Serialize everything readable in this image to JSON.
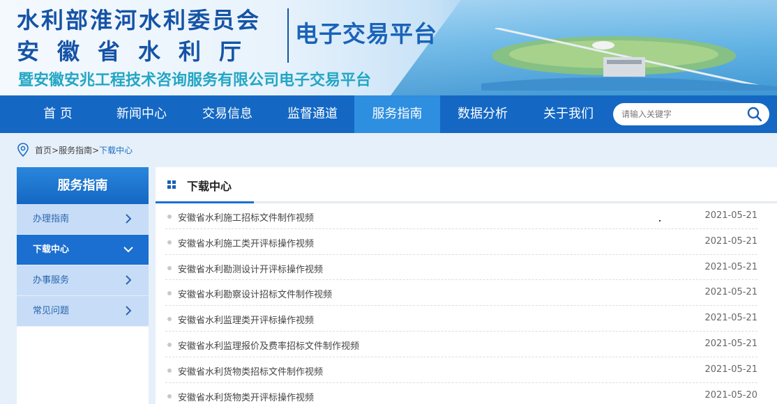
{
  "header": {
    "org_line1": "水利部淮河水利委员会",
    "org_line2": "安徽省水利厅",
    "platform": "电子交易平台",
    "org_line3": "暨安徽安兆工程技术咨询服务有限公司电子交易平台"
  },
  "nav": {
    "items": [
      {
        "label": "首 页"
      },
      {
        "label": "新闻中心"
      },
      {
        "label": "交易信息"
      },
      {
        "label": "监督通道"
      },
      {
        "label": "服务指南"
      },
      {
        "label": "数据分析"
      },
      {
        "label": "关于我们"
      }
    ],
    "active": "服务指南",
    "search_placeholder": "请输入关键字"
  },
  "breadcrumb": {
    "home": "首页>",
    "parent": "服务指南>",
    "current": "下载中心"
  },
  "sidebar": {
    "title": "服务指南",
    "items": [
      {
        "label": "办理指南",
        "icon": "chevron-right-icon"
      },
      {
        "label": "下载中心",
        "icon": "chevron-down-icon"
      },
      {
        "label": "办事服务",
        "icon": "chevron-right-icon"
      },
      {
        "label": "常见问题",
        "icon": "chevron-right-icon"
      }
    ],
    "active": "下载中心"
  },
  "main": {
    "title": "下载中心",
    "rows": [
      {
        "title": "安徽省水利施工招标文件制作视频",
        "date": "2021-05-21"
      },
      {
        "title": "安徽省水利施工类开评标操作视频",
        "date": "2021-05-21"
      },
      {
        "title": "安徽省水利勘测设计开评标操作视频",
        "date": "2021-05-21"
      },
      {
        "title": "安徽省水利勘察设计招标文件制作视频",
        "date": "2021-05-21"
      },
      {
        "title": "安徽省水利监理类开评标操作视频",
        "date": "2021-05-21"
      },
      {
        "title": "安徽省水利监理报价及费率招标文件制作视频",
        "date": "2021-05-21"
      },
      {
        "title": "安徽省水利货物类招标文件制作视频",
        "date": "2021-05-21"
      },
      {
        "title": "安徽省水利货物类开评标操作视频",
        "date": "2021-05-20"
      }
    ]
  },
  "colors": {
    "nav_bg": "#1468c4",
    "nav_active": "#2e8ee0",
    "accent": "#1a6fd0",
    "sidebar_item_bg": "#c7dcf6"
  }
}
